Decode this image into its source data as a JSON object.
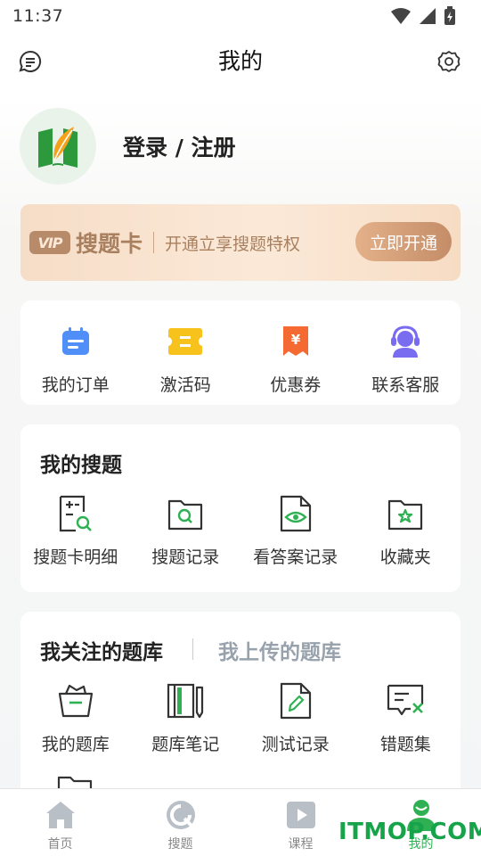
{
  "status_bar": {
    "time": "11:37"
  },
  "header": {
    "title": "我的",
    "left_icon": "message-icon",
    "right_icon": "gear-icon"
  },
  "profile": {
    "login_label": "登录 / 注册"
  },
  "vip": {
    "badge": "VIP",
    "title": "搜题卡",
    "description": "开通立享搜题特权",
    "button": "立即开通"
  },
  "quick_actions": [
    {
      "label": "我的订单",
      "icon": "order-calendar-icon",
      "color": "#4f8ff7"
    },
    {
      "label": "激活码",
      "icon": "ticket-code-icon",
      "color": "#f7c21c"
    },
    {
      "label": "优惠券",
      "icon": "coupon-icon",
      "color": "#f46a32"
    },
    {
      "label": "联系客服",
      "icon": "customer-service-icon",
      "color": "#7a6cf0"
    }
  ],
  "my_search": {
    "title": "我的搜题",
    "items": [
      {
        "label": "搜题卡明细",
        "icon": "search-detail-icon"
      },
      {
        "label": "搜题记录",
        "icon": "search-folder-icon"
      },
      {
        "label": "看答案记录",
        "icon": "answer-view-icon"
      },
      {
        "label": "收藏夹",
        "icon": "favorites-folder-icon"
      }
    ]
  },
  "question_bank": {
    "tab_active": "我关注的题库",
    "tab_inactive": "我上传的题库",
    "items": [
      {
        "label": "我的题库",
        "icon": "basket-icon"
      },
      {
        "label": "题库笔记",
        "icon": "notebook-icon"
      },
      {
        "label": "测试记录",
        "icon": "edit-document-icon"
      },
      {
        "label": "错题集",
        "icon": "wrong-questions-icon"
      }
    ]
  },
  "bottom_nav": [
    {
      "label": "首页",
      "icon": "home-icon",
      "active": false
    },
    {
      "label": "搜题",
      "icon": "search-nav-icon",
      "active": false
    },
    {
      "label": "课程",
      "icon": "play-course-icon",
      "active": false
    },
    {
      "label": "我的",
      "icon": "profile-icon",
      "active": true
    }
  ],
  "watermark": "ITMOP.COM",
  "colors": {
    "accent_green": "#2fb153",
    "vip_gold": "#a9805f",
    "icon_stroke": "#333333"
  }
}
